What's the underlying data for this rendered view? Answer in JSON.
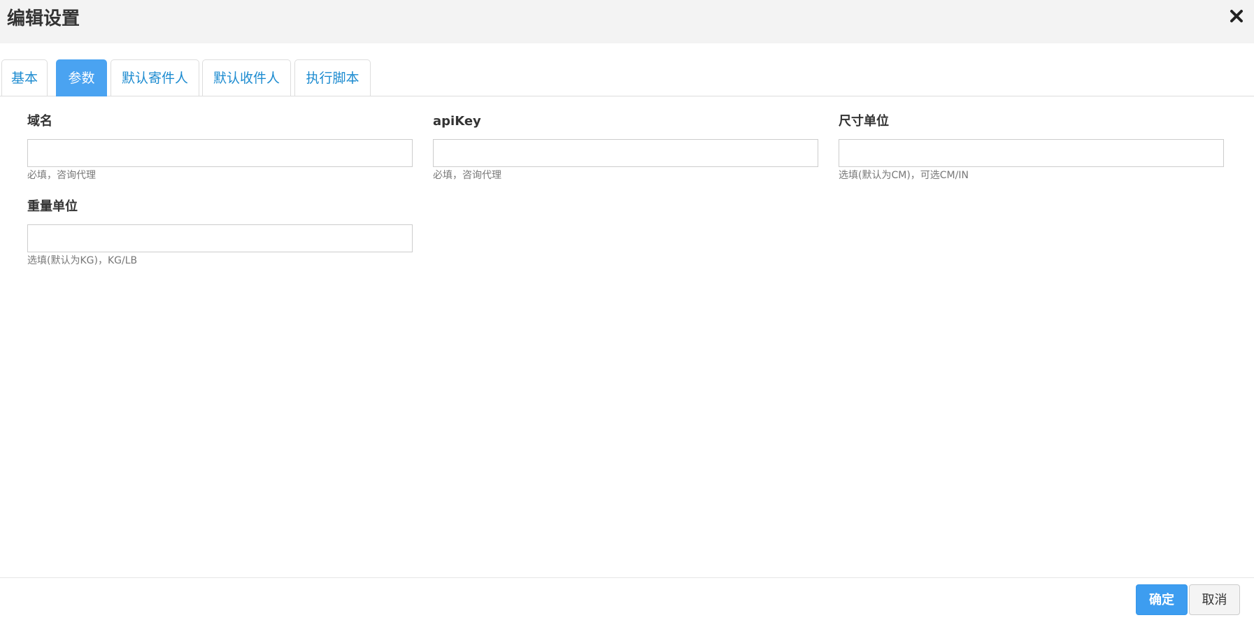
{
  "dialog": {
    "title": "编辑设置",
    "close_icon": "close-icon"
  },
  "tabs": [
    {
      "label": "基本",
      "active": false
    },
    {
      "label": "参数",
      "active": true
    },
    {
      "label": "默认寄件人",
      "active": false
    },
    {
      "label": "默认收件人",
      "active": false
    },
    {
      "label": "执行脚本",
      "active": false
    }
  ],
  "form": {
    "domain": {
      "label": "域名",
      "value": "",
      "help": "必填，咨询代理"
    },
    "apikey": {
      "label": "apiKey",
      "value": "",
      "help": "必填，咨询代理"
    },
    "size_unit": {
      "label": "尺寸单位",
      "value": "",
      "help": "选填(默认为CM)，可选CM/IN"
    },
    "weight_unit": {
      "label": "重量单位",
      "value": "",
      "help": "选填(默认为KG)，KG/LB"
    }
  },
  "footer": {
    "confirm_label": "确定",
    "cancel_label": "取消"
  },
  "colors": {
    "accent": "#4aa3f1",
    "link": "#1c8bd0",
    "header_bg": "#f3f3f3"
  }
}
